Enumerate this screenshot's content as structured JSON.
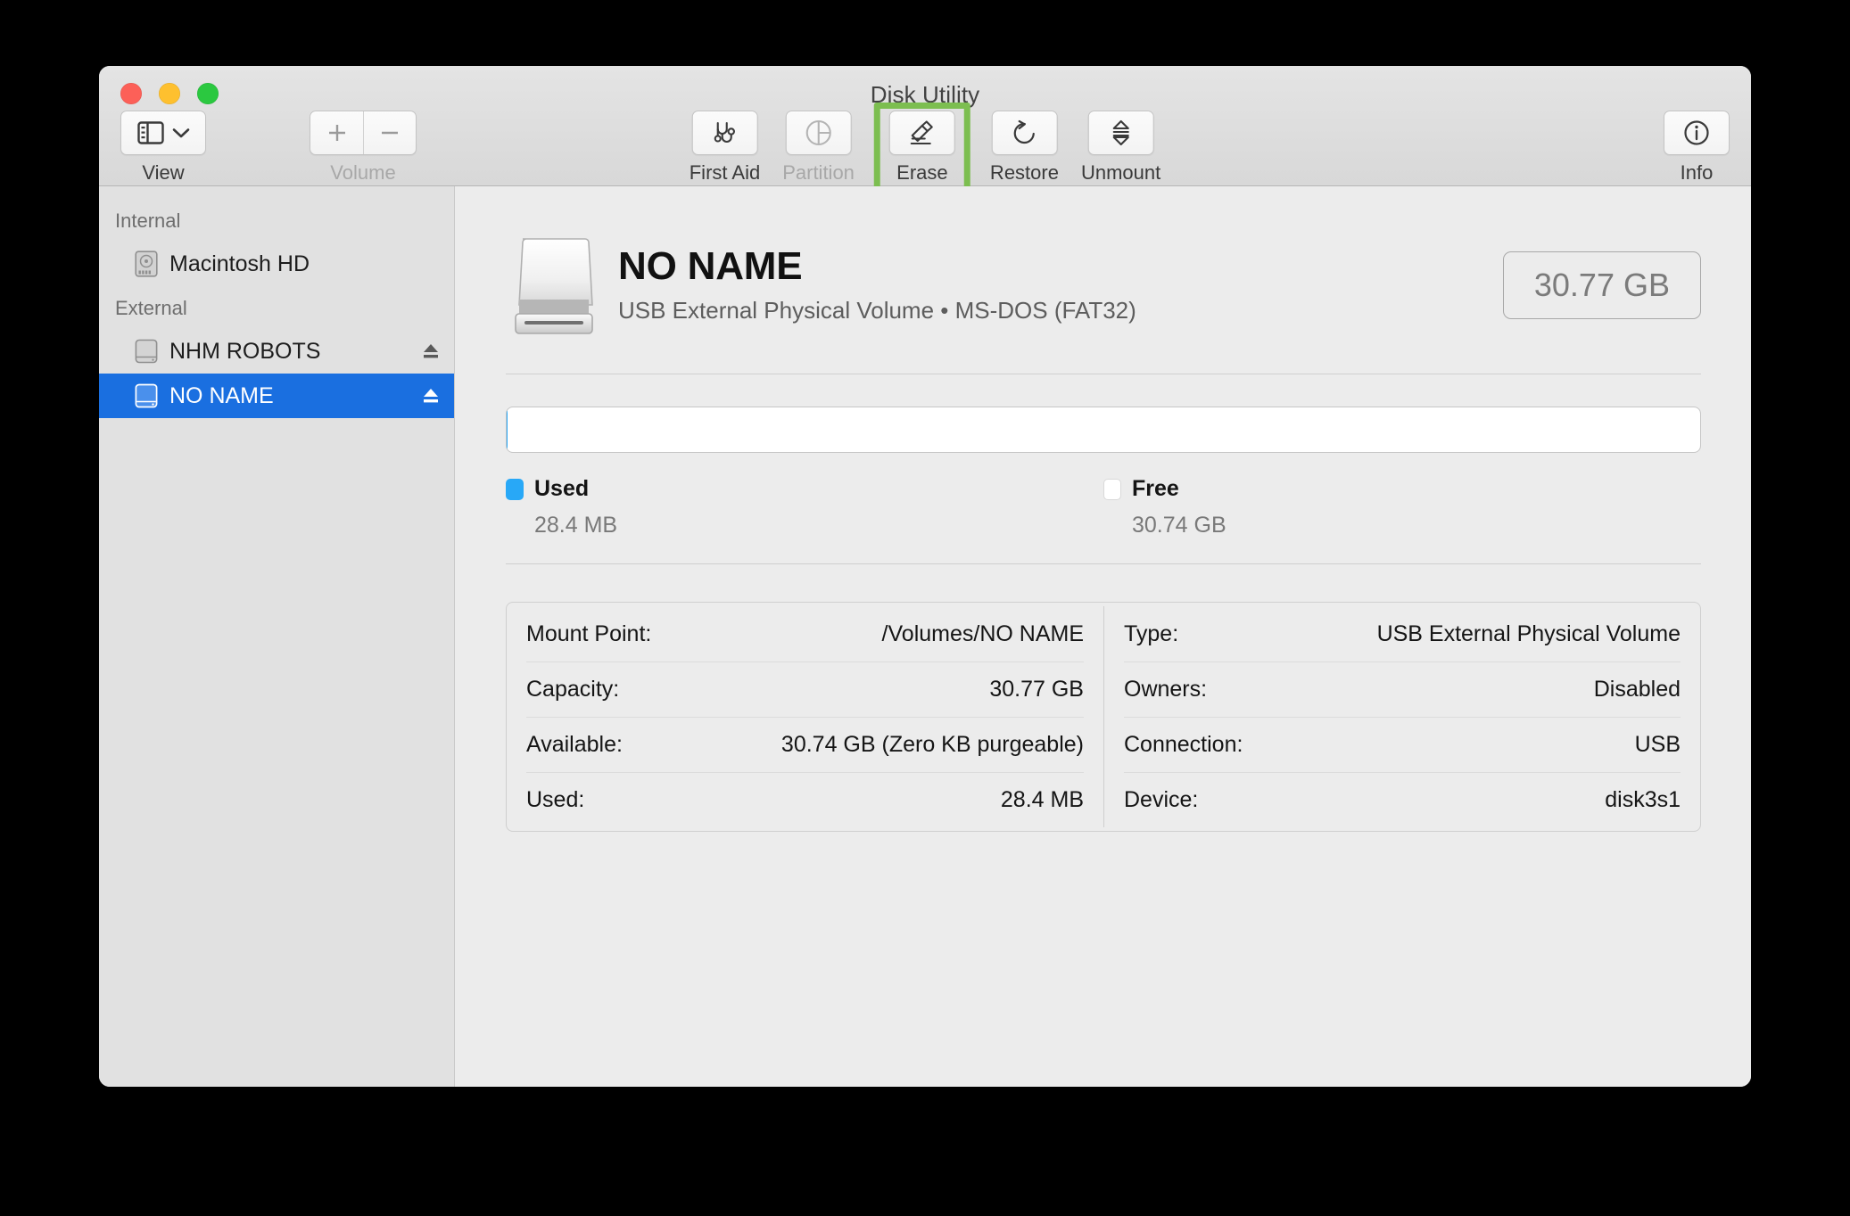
{
  "window": {
    "title": "Disk Utility",
    "traffic_lights": [
      "close-button",
      "minimize-button",
      "zoom-button"
    ],
    "accent_selection_color": "#1a6fe0",
    "highlight_color": "#7cbe50",
    "used_color": "#28a8f7"
  },
  "toolbar": {
    "view": {
      "label": "View",
      "icon": "sidebar-icon",
      "chevron": "chevron-down-icon"
    },
    "volume": {
      "label": "Volume",
      "add": "+",
      "remove": "−"
    },
    "tools": [
      {
        "label": "First Aid",
        "icon": "stethoscope-icon",
        "enabled": true,
        "highlighted": false
      },
      {
        "label": "Partition",
        "icon": "pie-chart-icon",
        "enabled": false,
        "highlighted": false
      },
      {
        "label": "Erase",
        "icon": "erase-icon",
        "enabled": true,
        "highlighted": true
      },
      {
        "label": "Restore",
        "icon": "undo-arrow-icon",
        "enabled": true,
        "highlighted": false
      },
      {
        "label": "Unmount",
        "icon": "eject-stack-icon",
        "enabled": true,
        "highlighted": false
      }
    ],
    "info": {
      "label": "Info",
      "icon": "info-circle-icon"
    }
  },
  "sidebar": {
    "sections": [
      {
        "title": "Internal",
        "items": [
          {
            "label": "Macintosh HD",
            "icon": "internal-disk-icon",
            "selected": false,
            "ejectable": false
          }
        ]
      },
      {
        "title": "External",
        "items": [
          {
            "label": "NHM ROBOTS",
            "icon": "external-disk-icon",
            "selected": false,
            "ejectable": true
          },
          {
            "label": "NO NAME",
            "icon": "external-disk-icon",
            "selected": true,
            "ejectable": true
          }
        ]
      }
    ]
  },
  "volume": {
    "icon": "external-drive-icon",
    "name": "NO NAME",
    "subtitle": "USB External Physical Volume • MS-DOS (FAT32)",
    "capacity_badge": "30.77 GB",
    "usage": {
      "used_percent": 0.09,
      "legend": [
        {
          "label": "Used",
          "value": "28.4 MB",
          "swatch": "used"
        },
        {
          "label": "Free",
          "value": "30.74 GB",
          "swatch": "free"
        }
      ]
    },
    "details_left": [
      {
        "key": "Mount Point:",
        "value": "/Volumes/NO NAME"
      },
      {
        "key": "Capacity:",
        "value": "30.77 GB"
      },
      {
        "key": "Available:",
        "value": "30.74 GB (Zero KB purgeable)"
      },
      {
        "key": "Used:",
        "value": "28.4 MB"
      }
    ],
    "details_right": [
      {
        "key": "Type:",
        "value": "USB External Physical Volume"
      },
      {
        "key": "Owners:",
        "value": "Disabled"
      },
      {
        "key": "Connection:",
        "value": "USB"
      },
      {
        "key": "Device:",
        "value": "disk3s1"
      }
    ]
  }
}
